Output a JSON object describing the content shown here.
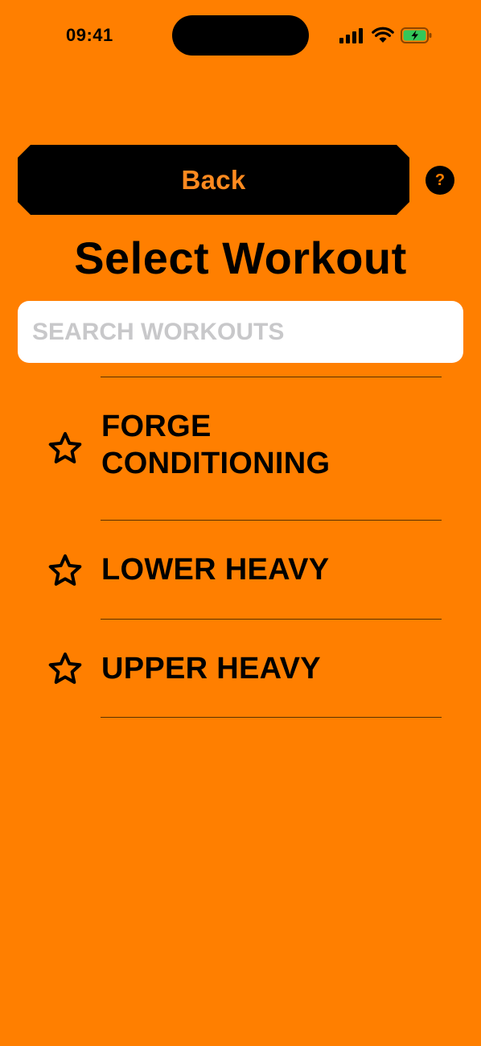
{
  "status_bar": {
    "time": "09:41"
  },
  "header": {
    "back_label": "Back",
    "help_label": "?"
  },
  "page": {
    "title": "Select Workout"
  },
  "search": {
    "placeholder": "SEARCH WORKOUTS",
    "value": ""
  },
  "workouts": [
    {
      "line1": "FORGE",
      "line2": "CONDITIONING",
      "favorite": false
    },
    {
      "line1": "LOWER HEAVY",
      "line2": "",
      "favorite": false
    },
    {
      "line1": "UPPER HEAVY",
      "line2": "",
      "favorite": false
    }
  ],
  "colors": {
    "background": "#FF7F00",
    "button": "#000000",
    "button_text": "#FF8A1F",
    "battery": "#34C759"
  }
}
